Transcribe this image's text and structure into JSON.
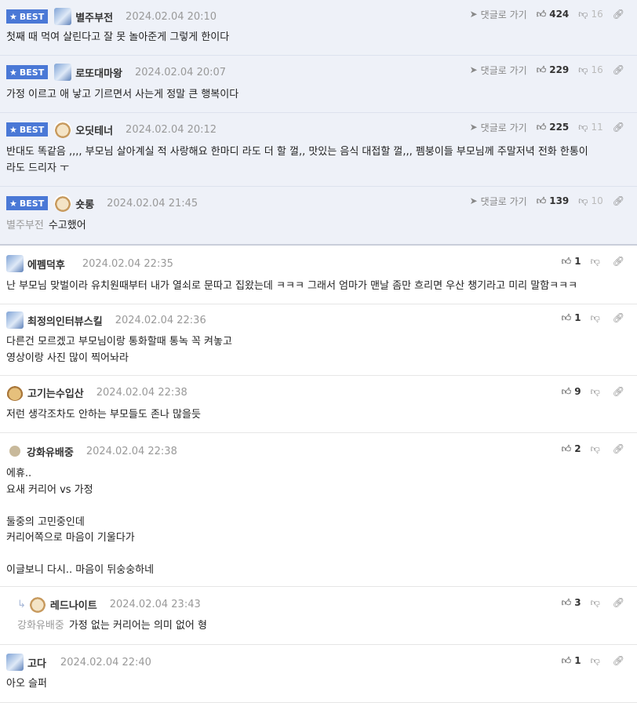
{
  "best_label": "BEST",
  "goto_label": "댓글로 가기",
  "best_comments": [
    {
      "nick": "별주부전",
      "date": "2024.02.04 20:10",
      "likes": "424",
      "dislikes": "16",
      "text": "첫째 때 먹여 살린다고 잘 못 놀아준게 그렇게 한이다"
    },
    {
      "nick": "로또대마왕",
      "date": "2024.02.04 20:07",
      "likes": "229",
      "dislikes": "16",
      "text": "가정 이르고 애 낳고 기르면서 사는게 정말 큰 행복이다"
    },
    {
      "nick": "오딧테너",
      "date": "2024.02.04 20:12",
      "likes": "225",
      "dislikes": "11",
      "text_line1": "반대도 똑같음 ,,,, 부모님 살아계실 적 사랑해요 한마디 라도 더 할 껄,, 맛있는 음식 대접할 껄,,, 펨붕이들 부모님께 주말저녁 전화 한통이",
      "text_line2": "라도 드리자 ㅜ"
    },
    {
      "nick": "숏롱",
      "date": "2024.02.04 21:45",
      "likes": "139",
      "dislikes": "10",
      "ref": "별주부전",
      "text": "수고했어"
    }
  ],
  "comments": [
    {
      "nick": "에펨덕후",
      "date": "2024.02.04 22:35",
      "likes": "1",
      "text": "난 부모님 맞벌이라 유치원때부터 내가 열쇠로 문따고 집왔는데 ㅋㅋㅋ 그래서 엄마가 맨날 좀만 흐리면 우산 챙기라고 미리 말함ㅋㅋㅋ"
    },
    {
      "nick": "최정의인터뷰스킬",
      "date": "2024.02.04 22:36",
      "likes": "1",
      "line1": "다른건 모르겠고 부모님이랑 통화할때 통녹 꼭 켜놓고",
      "line2": "영상이랑 사진 많이 찍어놔라"
    },
    {
      "nick": "고기는수입산",
      "date": "2024.02.04 22:38",
      "likes": "9",
      "text": "저런 생각조차도 안하는 부모들도 존나 많을듯"
    },
    {
      "nick": "강화유배중",
      "date": "2024.02.04 22:38",
      "likes": "2",
      "line1": "에휴..",
      "line2": "요새 커리어 vs 가정",
      "line3": "둘중의 고민중인데",
      "line4": "커리어쪽으로 마음이 기울다가",
      "line5": "이글보니 다시.. 마음이 뒤숭숭하네"
    },
    {
      "nick": "레드나이트",
      "date": "2024.02.04 23:43",
      "likes": "3",
      "ref": "강화유배중",
      "text": "가정 없는 커리어는 의미 없어 형"
    },
    {
      "nick": "고다",
      "date": "2024.02.04 22:40",
      "likes": "1",
      "text": "아오 슬퍼"
    }
  ]
}
